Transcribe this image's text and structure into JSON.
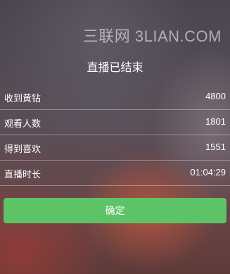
{
  "watermark": "三联网 3LIAN.COM",
  "title": "直播已结束",
  "stats": [
    {
      "label": "收到黄钻",
      "value": "4800"
    },
    {
      "label": "观看人数",
      "value": "1801"
    },
    {
      "label": "得到喜欢",
      "value": "1551"
    },
    {
      "label": "直播时长",
      "value": "01:04:29"
    }
  ],
  "confirm_label": "确定",
  "colors": {
    "confirm_button": "#5cc366",
    "text": "#ffffff"
  }
}
